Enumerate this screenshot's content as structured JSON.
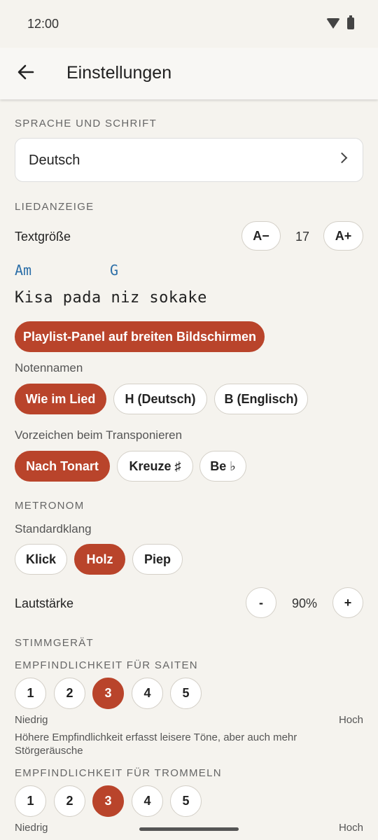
{
  "status": {
    "time": "12:00"
  },
  "header": {
    "title": "Einstellungen"
  },
  "language": {
    "section": "SPRACHE UND SCHRIFT",
    "value": "Deutsch"
  },
  "song_display": {
    "section": "LIEDANZEIGE",
    "text_size_label": "Textgröße",
    "decrease_label": "A−",
    "size_value": "17",
    "increase_label": "A+",
    "chord_1": "Am",
    "chord_2": "G",
    "lyric": "Kisa pada niz sokake",
    "playlist_toggle": "Playlist-Panel auf breiten Bildschirmen"
  },
  "note_names": {
    "label": "Notennamen",
    "options": [
      "Wie im Lied",
      "H (Deutsch)",
      "B (Englisch)"
    ],
    "selected": "Wie im Lied"
  },
  "accidentals": {
    "label": "Vorzeichen beim Transponieren",
    "options": [
      "Nach Tonart",
      "Kreuze ♯",
      "Be ♭"
    ],
    "selected": "Nach Tonart"
  },
  "metronome": {
    "section": "METRONOM",
    "sound_label": "Standardklang",
    "sounds": [
      "Klick",
      "Holz",
      "Piep"
    ],
    "selected_sound": "Holz",
    "volume_label": "Lautstärke",
    "volume_minus": "-",
    "volume_value": "90%",
    "volume_plus": "+"
  },
  "tuner": {
    "section": "STIMMGERÄT",
    "strings_label": "EMPFINDLICHKEIT FÜR SAITEN",
    "strings_levels": [
      "1",
      "2",
      "3",
      "4",
      "5"
    ],
    "strings_selected": "3",
    "low": "Niedrig",
    "high": "Hoch",
    "hint": "Höhere Empfindlichkeit erfasst leisere Töne, aber auch mehr Störgeräusche",
    "drums_label": "EMPFINDLICHKEIT FÜR TROMMELN",
    "drums_levels": [
      "1",
      "2",
      "3",
      "4",
      "5"
    ],
    "drums_selected": "3"
  },
  "colors": {
    "accent": "#b9442b",
    "chord": "#2c6fa8",
    "background": "#f5f3ee"
  }
}
